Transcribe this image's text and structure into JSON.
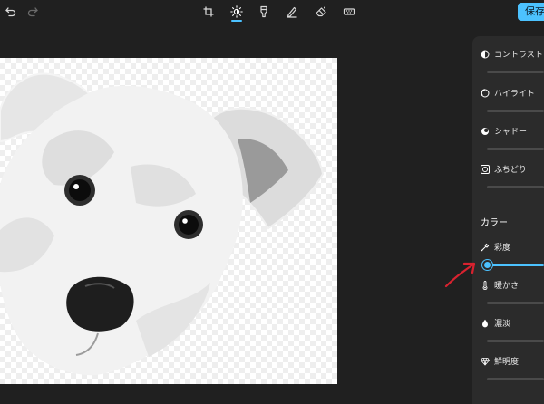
{
  "toolbar": {
    "undo_icon": "undo-icon",
    "redo_icon": "redo-icon",
    "tools": [
      "crop-icon",
      "adjust-brightness-icon",
      "filter-icon",
      "markup-pen-icon",
      "background-erase-icon",
      "retouch-icon"
    ],
    "save_label": "保存",
    "accent": "#4cc2ff"
  },
  "canvas": {
    "image": "white-dog-cutout",
    "background": "transparent-checkerboard"
  },
  "panel": {
    "light_items": [
      {
        "label": "コントラスト",
        "icon": "contrast-icon"
      },
      {
        "label": "ハイライト",
        "icon": "highlight-icon"
      },
      {
        "label": "シャドー",
        "icon": "shadow-icon"
      },
      {
        "label": "ふちどり",
        "icon": "vignette-icon"
      }
    ],
    "color_section": "カラー",
    "color_items": [
      {
        "label": "彩度",
        "icon": "eyedropper-icon"
      },
      {
        "label": "暖かさ",
        "icon": "thermometer-icon"
      },
      {
        "label": "濃淡",
        "icon": "droplet-icon"
      },
      {
        "label": "鮮明度",
        "icon": "diamond-icon"
      }
    ],
    "saturation_value": 0
  },
  "annotation": {
    "color": "#d8222f",
    "icon": "red-arrow-icon"
  }
}
